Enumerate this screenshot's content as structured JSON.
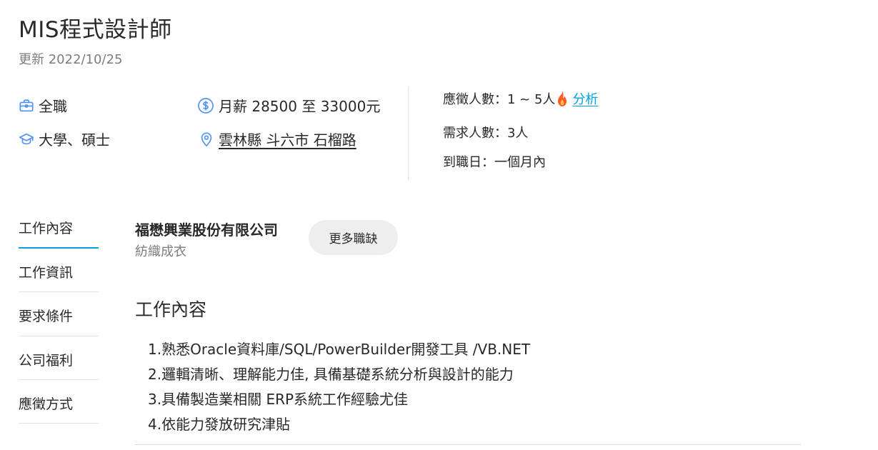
{
  "job": {
    "title": "MIS程式設計師",
    "updated": "更新 2022/10/25"
  },
  "info": {
    "job_type": "全職",
    "education": "大學、碩士",
    "salary": "月薪 28500 至 33000元",
    "location": "雲林縣 斗六市 石榴路"
  },
  "stats": {
    "applicants": "應徵人數：1 ~ 5人",
    "analysis_link": "分析",
    "headcount": "需求人數：3人",
    "start_date": "到職日：一個月內"
  },
  "nav": {
    "items": [
      {
        "label": "工作內容"
      },
      {
        "label": "工作資訊"
      },
      {
        "label": "要求條件"
      },
      {
        "label": "公司福利"
      },
      {
        "label": "應徵方式"
      }
    ],
    "active": "工作內容"
  },
  "company": {
    "name": "福懋興業股份有限公司",
    "industry": "紡織成衣",
    "more_jobs_label": "更多職缺"
  },
  "content": {
    "section_title": "工作內容",
    "lines": [
      "1.熟悉Oracle資料庫/SQL/PowerBuilder開發工具 /VB.NET",
      "2.邏輯清晰、理解能力佳, 具備基礎系統分析與設計的能力",
      "3.具備製造業相關 ERP系統工作經驗尤佳",
      "4.依能力發放研究津貼"
    ]
  },
  "colors": {
    "accent": "#00a2e0",
    "icon": "#4e91ff",
    "muted": "#7e7e7e",
    "text": "#292929",
    "fire": "#ff5b22"
  },
  "icons": [
    "briefcase-icon",
    "graduation-cap-icon",
    "dollar-circle-icon",
    "location-pin-icon",
    "fire-icon"
  ]
}
